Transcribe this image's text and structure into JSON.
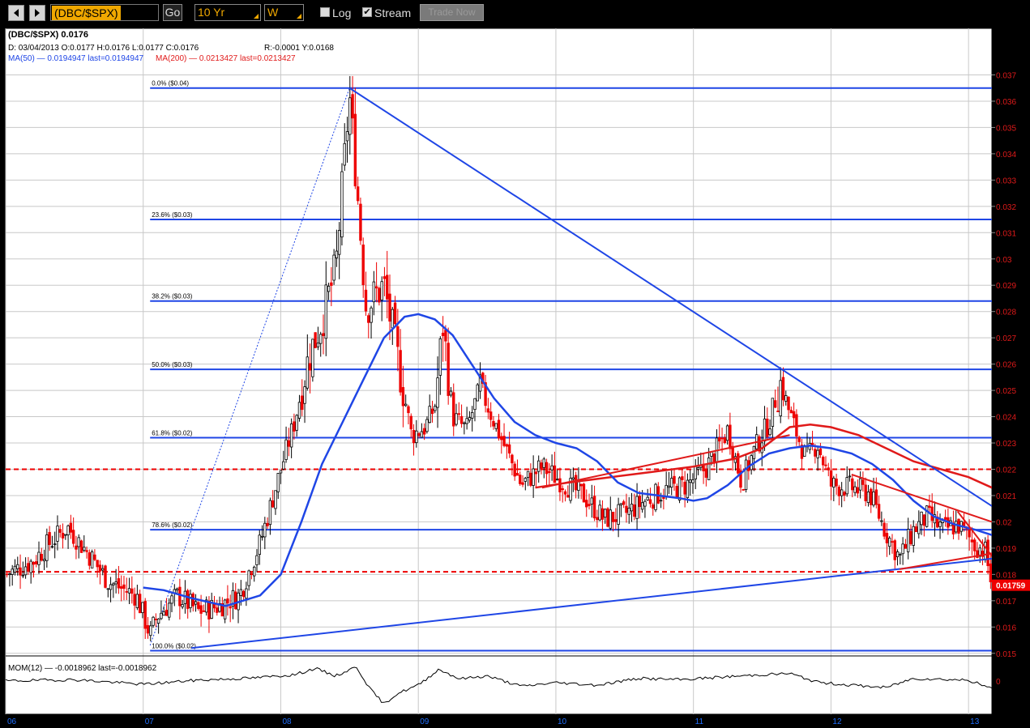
{
  "toolbar": {
    "symbol": "(DBC/$SPX)",
    "go_label": "Go",
    "range_value": "10 Yr",
    "period_value": "W",
    "log_label": "Log",
    "log_checked": false,
    "stream_label": "Stream",
    "stream_checked": true,
    "trade_label": "Trade Now"
  },
  "header": {
    "title": "(DBC/$SPX)  0.0176",
    "ohlc": "D: 03/04/2013 O:0.0177 H:0.0176 L:0.0177 C:0.0176",
    "range": "R:-0.0001 Y:0.0168",
    "ma50": "MA(50) — 0.0194947 last=0.0194947",
    "ma200": "MA(200) — 0.0213427 last=0.0213427"
  },
  "colors": {
    "background": "#ffffff",
    "grid": "#c8c8c8",
    "up_candle": "#000000",
    "down_candle": "#ee0000",
    "ma50": "#1f46e6",
    "ma200": "#e01a1a",
    "fib_line": "#1f46e6",
    "support_dashed": "#ee0000",
    "price_label_bg": "#ee0000",
    "axis_text": "#e01a1a"
  },
  "chart_data": {
    "type": "candlestick",
    "title": "(DBC/$SPX)",
    "period": "weekly",
    "x_axis_labels": [
      "06",
      "07",
      "08",
      "09",
      "10",
      "11",
      "12",
      "13"
    ],
    "y_axis_ticks": [
      "0.015",
      "0.016",
      "0.017",
      "0.018",
      "0.019",
      "0.02",
      "0.021",
      "0.022",
      "0.023",
      "0.024",
      "0.025",
      "0.026",
      "0.027",
      "0.028",
      "0.029",
      "0.03",
      "0.031",
      "0.032",
      "0.033",
      "0.034",
      "0.035",
      "0.036",
      "0.037"
    ],
    "ylim": [
      0.0149,
      0.0372
    ],
    "xlim": [
      2006.0,
      2013.17
    ],
    "last_price_label": "0.01759",
    "last_price": 0.01759,
    "anchors": [
      [
        2006.0,
        0.018
      ],
      [
        2006.2,
        0.0185
      ],
      [
        2006.3,
        0.0191
      ],
      [
        2006.45,
        0.0198
      ],
      [
        2006.6,
        0.0188
      ],
      [
        2006.75,
        0.0177
      ],
      [
        2006.95,
        0.0172
      ],
      [
        2007.05,
        0.0157
      ],
      [
        2007.1,
        0.0164
      ],
      [
        2007.25,
        0.0172
      ],
      [
        2007.4,
        0.0166
      ],
      [
        2007.55,
        0.0168
      ],
      [
        2007.7,
        0.0172
      ],
      [
        2007.85,
        0.0192
      ],
      [
        2008.0,
        0.022
      ],
      [
        2008.1,
        0.0238
      ],
      [
        2008.2,
        0.0262
      ],
      [
        2008.3,
        0.0277
      ],
      [
        2008.4,
        0.0296
      ],
      [
        2008.5,
        0.0362
      ],
      [
        2008.55,
        0.033
      ],
      [
        2008.62,
        0.0282
      ],
      [
        2008.75,
        0.029
      ],
      [
        2008.85,
        0.0262
      ],
      [
        2008.95,
        0.0233
      ],
      [
        2009.05,
        0.0236
      ],
      [
        2009.12,
        0.0244
      ],
      [
        2009.18,
        0.0275
      ],
      [
        2009.25,
        0.024
      ],
      [
        2009.35,
        0.0235
      ],
      [
        2009.45,
        0.0251
      ],
      [
        2009.6,
        0.0232
      ],
      [
        2009.75,
        0.0214
      ],
      [
        2009.9,
        0.0221
      ],
      [
        2010.05,
        0.0215
      ],
      [
        2010.2,
        0.021
      ],
      [
        2010.35,
        0.0201
      ],
      [
        2010.5,
        0.0203
      ],
      [
        2010.65,
        0.0208
      ],
      [
        2010.8,
        0.0212
      ],
      [
        2010.95,
        0.0214
      ],
      [
        2011.1,
        0.0221
      ],
      [
        2011.25,
        0.0235
      ],
      [
        2011.35,
        0.0215
      ],
      [
        2011.45,
        0.0228
      ],
      [
        2011.55,
        0.0238
      ],
      [
        2011.63,
        0.0253
      ],
      [
        2011.72,
        0.0238
      ],
      [
        2011.82,
        0.0224
      ],
      [
        2011.9,
        0.023
      ],
      [
        2012.0,
        0.0214
      ],
      [
        2012.15,
        0.0213
      ],
      [
        2012.28,
        0.0211
      ],
      [
        2012.4,
        0.0196
      ],
      [
        2012.5,
        0.0186
      ],
      [
        2012.6,
        0.0197
      ],
      [
        2012.7,
        0.0202
      ],
      [
        2012.82,
        0.0197
      ],
      [
        2012.92,
        0.0199
      ],
      [
        2013.05,
        0.0191
      ],
      [
        2013.12,
        0.0189
      ],
      [
        2013.17,
        0.01759
      ]
    ],
    "ma50_points": [
      [
        2007.0,
        0.0175
      ],
      [
        2007.15,
        0.0174
      ],
      [
        2007.35,
        0.0171
      ],
      [
        2007.6,
        0.0168
      ],
      [
        2007.85,
        0.0172
      ],
      [
        2008.0,
        0.018
      ],
      [
        2008.15,
        0.02
      ],
      [
        2008.3,
        0.0222
      ],
      [
        2008.45,
        0.0238
      ],
      [
        2008.6,
        0.0254
      ],
      [
        2008.75,
        0.027
      ],
      [
        2008.9,
        0.0278
      ],
      [
        2009.0,
        0.0279
      ],
      [
        2009.12,
        0.0277
      ],
      [
        2009.25,
        0.0271
      ],
      [
        2009.4,
        0.0259
      ],
      [
        2009.55,
        0.0247
      ],
      [
        2009.7,
        0.0238
      ],
      [
        2009.85,
        0.0233
      ],
      [
        2010.0,
        0.023
      ],
      [
        2010.15,
        0.0228
      ],
      [
        2010.3,
        0.0223
      ],
      [
        2010.45,
        0.0215
      ],
      [
        2010.6,
        0.0211
      ],
      [
        2010.75,
        0.021
      ],
      [
        2010.9,
        0.0209
      ],
      [
        2011.0,
        0.0208
      ],
      [
        2011.1,
        0.0209
      ],
      [
        2011.25,
        0.0214
      ],
      [
        2011.4,
        0.0221
      ],
      [
        2011.55,
        0.0226
      ],
      [
        2011.7,
        0.0228
      ],
      [
        2011.85,
        0.0229
      ],
      [
        2012.0,
        0.0228
      ],
      [
        2012.15,
        0.0226
      ],
      [
        2012.3,
        0.0222
      ],
      [
        2012.45,
        0.0216
      ],
      [
        2012.6,
        0.0208
      ],
      [
        2012.75,
        0.0202
      ],
      [
        2012.9,
        0.0199
      ],
      [
        2013.05,
        0.0197
      ],
      [
        2013.17,
        0.0195
      ]
    ],
    "ma200_points": [
      [
        2009.85,
        0.0213
      ],
      [
        2010.1,
        0.0215
      ],
      [
        2010.4,
        0.0217
      ],
      [
        2010.7,
        0.0219
      ],
      [
        2011.0,
        0.0221
      ],
      [
        2011.3,
        0.0224
      ],
      [
        2011.5,
        0.0228
      ],
      [
        2011.7,
        0.0236
      ],
      [
        2011.85,
        0.0237
      ],
      [
        2012.0,
        0.0236
      ],
      [
        2012.2,
        0.0233
      ],
      [
        2012.4,
        0.0228
      ],
      [
        2012.6,
        0.0223
      ],
      [
        2012.8,
        0.022
      ],
      [
        2013.0,
        0.0217
      ],
      [
        2013.17,
        0.0213
      ]
    ],
    "fib_levels": [
      {
        "label": "0.0%   ($0.04)",
        "value": 0.0365
      },
      {
        "label": "23.6%   ($0.03)",
        "value": 0.0315
      },
      {
        "label": "38.2%   ($0.03)",
        "value": 0.0284
      },
      {
        "label": "50.0%   ($0.03)",
        "value": 0.0258
      },
      {
        "label": "61.8%   ($0.02)",
        "value": 0.0232
      },
      {
        "label": "78.6%   ($0.02)",
        "value": 0.0197
      },
      {
        "label": "100.0%   ($0.02)",
        "value": 0.0151
      }
    ],
    "dashed_levels": [
      0.022,
      0.0181
    ],
    "trendlines": [
      {
        "color": "blue",
        "from": [
          2008.5,
          0.0365
        ],
        "to": [
          2013.17,
          0.0206
        ]
      },
      {
        "color": "blue",
        "from": [
          2007.35,
          0.0152
        ],
        "to": [
          2013.17,
          0.0186
        ]
      },
      {
        "color": "red",
        "from": [
          2009.9,
          0.0213
        ],
        "to": [
          2011.7,
          0.0233
        ]
      },
      {
        "color": "red",
        "from": [
          2012.15,
          0.0218
        ],
        "to": [
          2013.17,
          0.02
        ]
      },
      {
        "color": "red",
        "from": [
          2012.5,
          0.0182
        ],
        "to": [
          2013.17,
          0.0188
        ]
      },
      {
        "color": "red",
        "from": [
          2012.92,
          0.0204
        ],
        "to": [
          2013.17,
          0.0187
        ]
      }
    ],
    "fib_projection": {
      "from": [
        2007.05,
        0.0153
      ],
      "to": [
        2008.5,
        0.0365
      ]
    },
    "momentum": {
      "label": "MOM(12) — -0.0018962 last=-0.0018962",
      "zero_label": "0",
      "ylim": [
        -0.008,
        0.006
      ],
      "anchors": [
        [
          2006.0,
          0.0
        ],
        [
          2006.5,
          0.0003
        ],
        [
          2007.0,
          -0.0008
        ],
        [
          2007.4,
          0.0002
        ],
        [
          2007.8,
          0.0007
        ],
        [
          2008.1,
          0.0015
        ],
        [
          2008.25,
          0.003
        ],
        [
          2008.4,
          0.0012
        ],
        [
          2008.55,
          0.0034
        ],
        [
          2008.65,
          -0.002
        ],
        [
          2008.75,
          -0.0055
        ],
        [
          2008.85,
          -0.003
        ],
        [
          2009.0,
          -0.001
        ],
        [
          2009.15,
          0.0028
        ],
        [
          2009.3,
          0.0005
        ],
        [
          2009.5,
          0.0012
        ],
        [
          2009.75,
          -0.0013
        ],
        [
          2010.0,
          -0.0004
        ],
        [
          2010.3,
          -0.001
        ],
        [
          2010.6,
          0.0006
        ],
        [
          2010.9,
          0.0003
        ],
        [
          2011.2,
          0.0009
        ],
        [
          2011.5,
          0.0015
        ],
        [
          2011.7,
          0.0018
        ],
        [
          2011.9,
          -0.0003
        ],
        [
          2012.1,
          -0.0009
        ],
        [
          2012.4,
          -0.0016
        ],
        [
          2012.6,
          0.0006
        ],
        [
          2012.8,
          0.0004
        ],
        [
          2013.0,
          0.0002
        ],
        [
          2013.17,
          -0.0019
        ]
      ]
    }
  }
}
